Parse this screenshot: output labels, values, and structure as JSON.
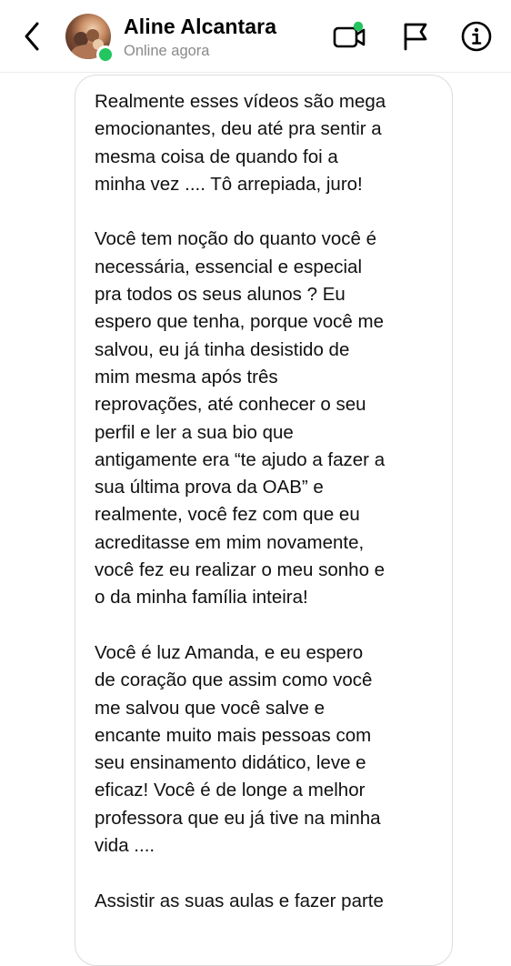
{
  "header": {
    "contact_name": "Aline Alcantara",
    "status": "Online agora",
    "back_icon": "chevron-left-icon",
    "video_icon": "video-call-icon",
    "flag_icon": "flag-icon",
    "info_icon": "info-icon",
    "online_color": "#22c55e"
  },
  "message": {
    "paragraphs": [
      [
        "Realmente esses vídeos são mega",
        "emocionantes, deu até pra sentir a",
        "mesma coisa de quando foi a",
        "minha vez .... Tô arrepiada, juro!"
      ],
      [
        "Você tem noção do quanto você é",
        "necessária, essencial e especial",
        "pra todos os seus alunos ? Eu",
        "espero que tenha, porque você me",
        "salvou, eu já tinha desistido de",
        "mim mesma após três",
        "reprovações, até conhecer o seu",
        "perfil e ler a sua bio que",
        "antigamente era “te ajudo a fazer a",
        "sua última prova da OAB” e",
        "realmente, você fez com que eu",
        "acreditasse em mim novamente,",
        "você fez eu realizar o meu sonho e",
        "o da minha família inteira!"
      ],
      [
        "Você é luz Amanda, e eu espero",
        "de coração que assim como você",
        "me salvou que você salve e",
        "encante muito mais pessoas com",
        "seu ensinamento didático, leve e",
        "eficaz! Você é de longe a melhor",
        "professora que eu já tive na minha",
        "vida ...."
      ],
      [
        "Assistir as suas aulas e fazer parte"
      ]
    ]
  }
}
